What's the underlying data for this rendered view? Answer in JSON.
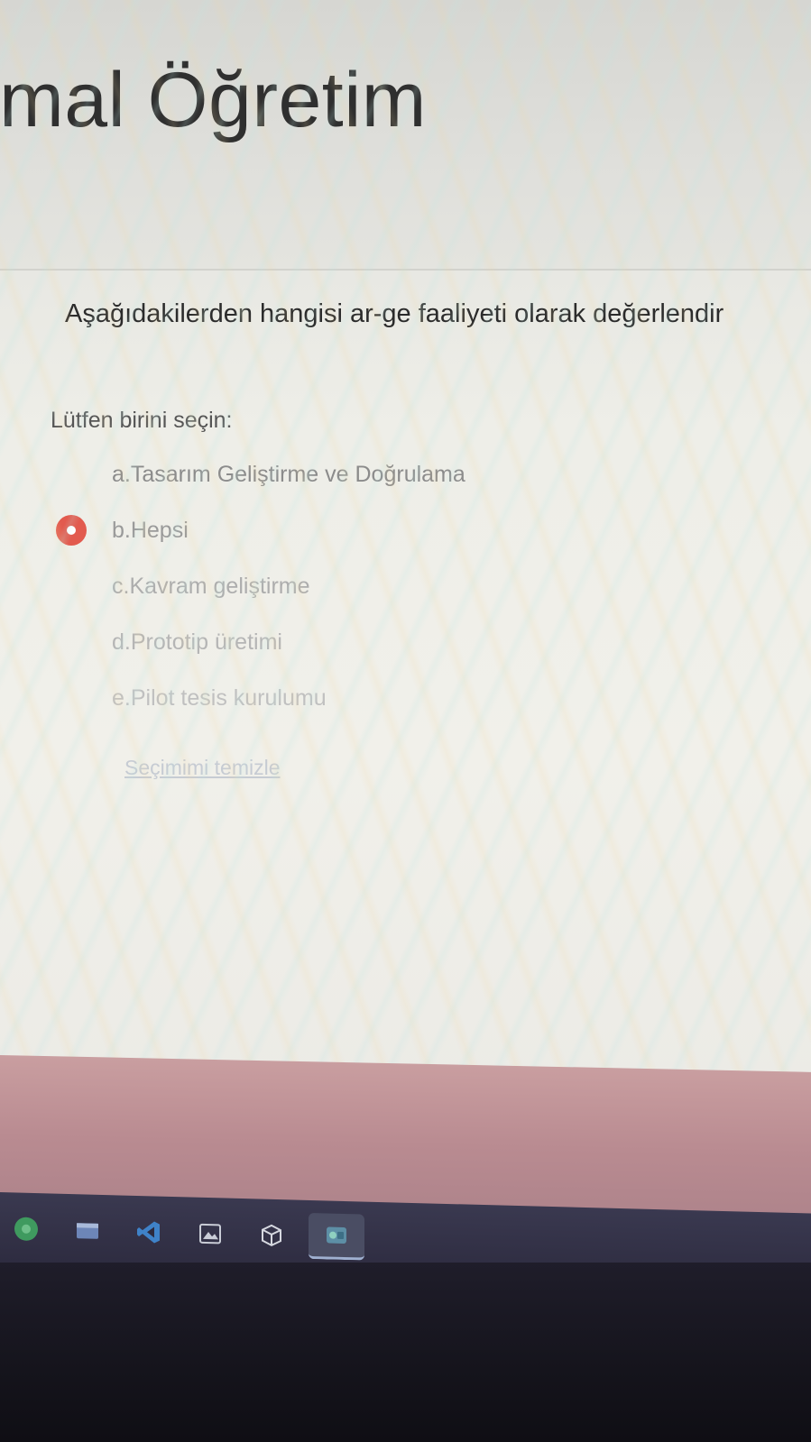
{
  "course": {
    "title": "rmal Öğretim"
  },
  "question": {
    "text": "Aşağıdakilerden hangisi ar-ge faaliyeti olarak değerlendir",
    "prompt": "Lütfen birini seçin:",
    "answers": [
      {
        "label": "a.Tasarım Geliştirme ve Doğrulama",
        "selected": false
      },
      {
        "label": "b.Hepsi",
        "selected": true
      },
      {
        "label": "c.Kavram geliştirme",
        "selected": false
      },
      {
        "label": "d.Prototip üretimi",
        "selected": false
      },
      {
        "label": "e.Pilot tesis kurulumu",
        "selected": false
      }
    ],
    "clear_label": "Seçimimi temizle"
  },
  "taskbar": {
    "icons": [
      "chrome-icon",
      "file-explorer-icon",
      "vscode-icon",
      "image-viewer-icon",
      "box-icon",
      "app-window-icon"
    ]
  },
  "colors": {
    "selected_radio": "#e25a4e",
    "footer": "#b98b91",
    "taskbar": "#2c2a3e"
  }
}
